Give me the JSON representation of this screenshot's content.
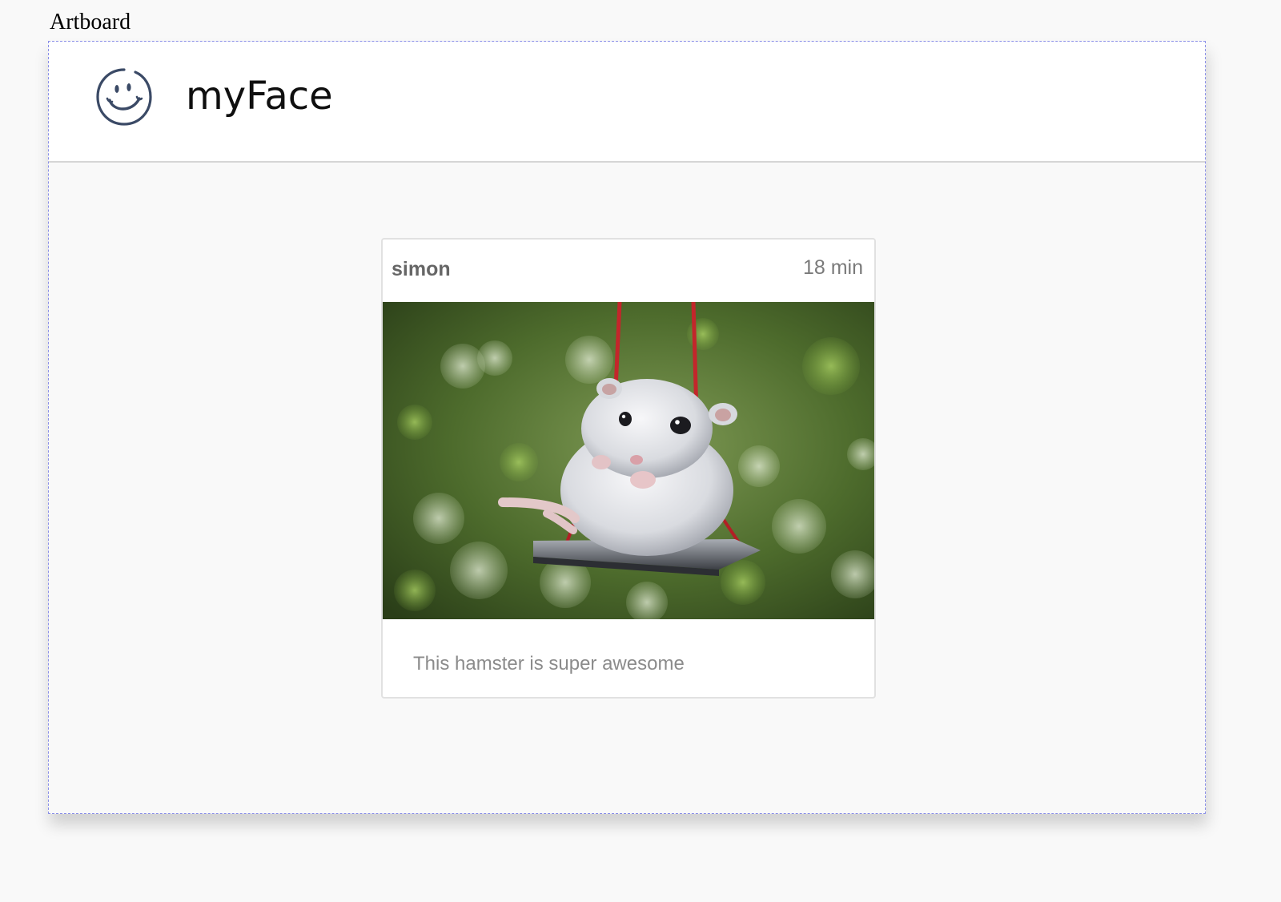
{
  "artboard": {
    "label": "Artboard"
  },
  "app": {
    "title": "myFace",
    "logo_icon": "smiley-face-icon"
  },
  "post": {
    "author": "simon",
    "time": "18 min",
    "image": "hamster-on-swing-photo",
    "caption": "This hamster is super awesome"
  },
  "colors": {
    "page_background": "#f9f9f9",
    "header_background": "#ffffff",
    "artboard_border": "#8a8fe8",
    "logo_stroke": "#3b4a66",
    "author_text": "#666666",
    "caption_text": "#8b8b8b"
  }
}
